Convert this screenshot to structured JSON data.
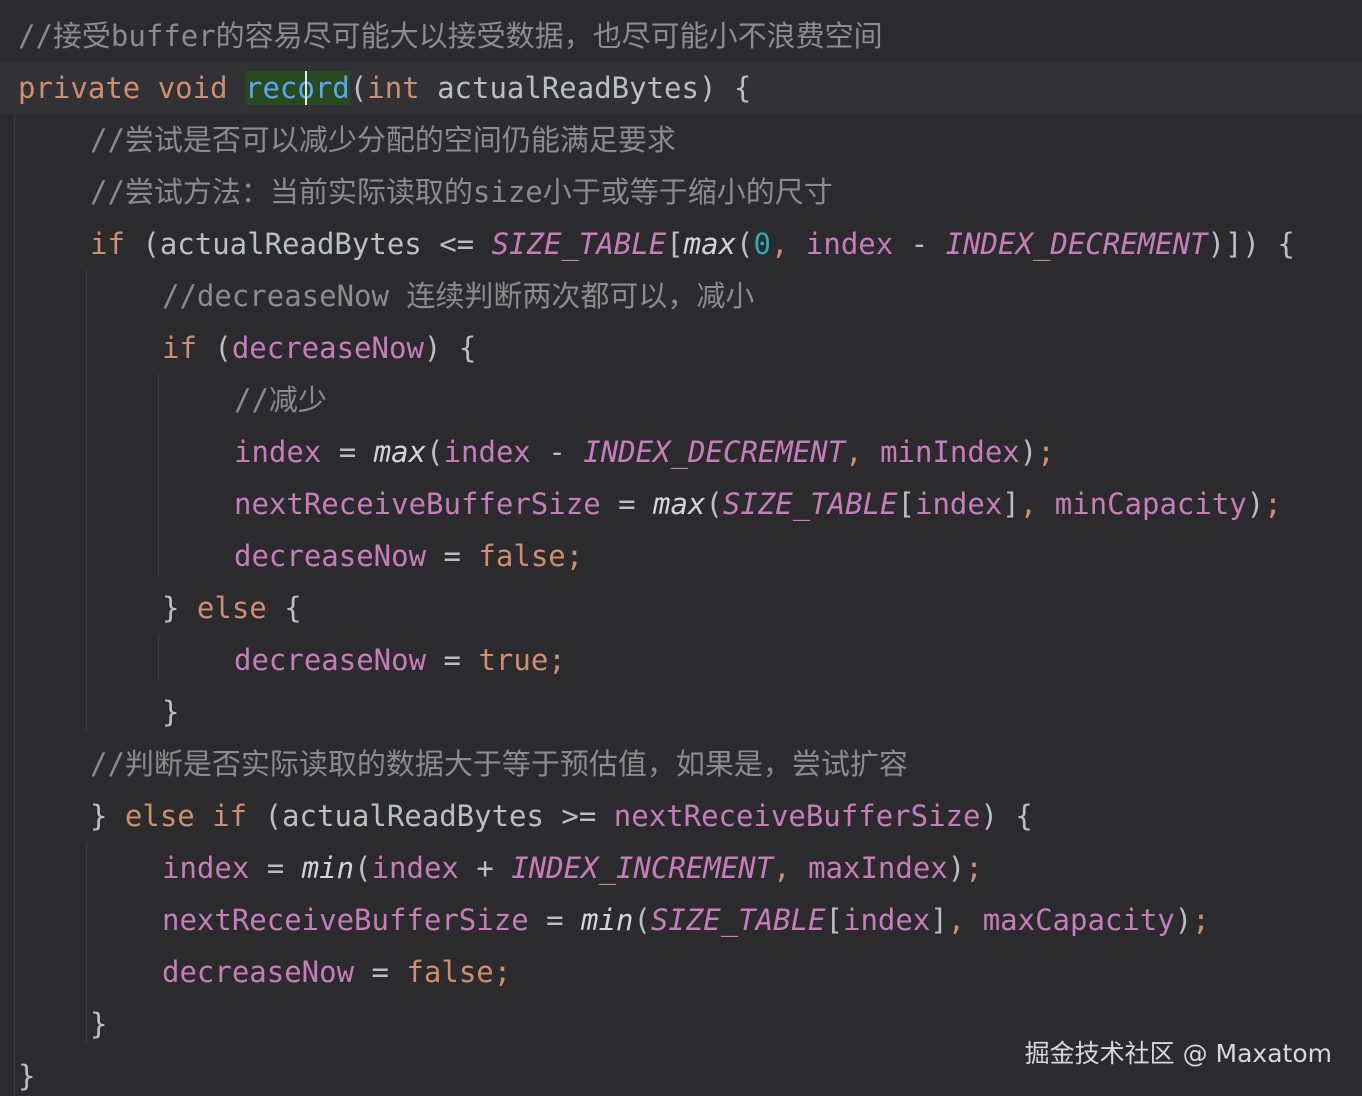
{
  "code": {
    "lines": [
      {
        "indent": 0,
        "tokens": [
          {
            "t": "//接受buffer的容易尽可能大以接受数据，也尽可能小不浪费空间",
            "c": "comment"
          }
        ]
      },
      {
        "indent": 0,
        "current": true,
        "tokens": [
          {
            "t": "private",
            "c": "keyword"
          },
          {
            "t": " ",
            "c": "plain"
          },
          {
            "t": "void",
            "c": "keyword"
          },
          {
            "t": " ",
            "c": "plain"
          },
          {
            "t": "record",
            "c": "method",
            "highlight": true
          },
          {
            "t": "(",
            "c": "plain"
          },
          {
            "t": "int",
            "c": "keyword"
          },
          {
            "t": " actualReadBytes) {",
            "c": "plain"
          }
        ]
      },
      {
        "indent": 1,
        "tokens": [
          {
            "t": "//尝试是否可以减少分配的空间仍能满足要求",
            "c": "comment"
          }
        ]
      },
      {
        "indent": 1,
        "tokens": [
          {
            "t": "//尝试方法：当前实际读取的size小于或等于缩小的尺寸",
            "c": "comment"
          }
        ]
      },
      {
        "indent": 1,
        "tokens": [
          {
            "t": "if",
            "c": "keyword"
          },
          {
            "t": " (actualReadBytes <= ",
            "c": "plain"
          },
          {
            "t": "SIZE_TABLE",
            "c": "static"
          },
          {
            "t": "[",
            "c": "plain"
          },
          {
            "t": "max",
            "c": "italic"
          },
          {
            "t": "(",
            "c": "plain"
          },
          {
            "t": "0",
            "c": "number"
          },
          {
            "t": ", ",
            "c": "keyword"
          },
          {
            "t": "index",
            "c": "field"
          },
          {
            "t": " - ",
            "c": "plain"
          },
          {
            "t": "INDEX_DECREMENT",
            "c": "static"
          },
          {
            "t": ")]) {",
            "c": "plain"
          }
        ]
      },
      {
        "indent": 2,
        "tokens": [
          {
            "t": "//decreaseNow 连续判断两次都可以，减小",
            "c": "comment"
          }
        ]
      },
      {
        "indent": 2,
        "tokens": [
          {
            "t": "if",
            "c": "keyword"
          },
          {
            "t": " (",
            "c": "plain"
          },
          {
            "t": "decreaseNow",
            "c": "field"
          },
          {
            "t": ") {",
            "c": "plain"
          }
        ]
      },
      {
        "indent": 3,
        "tokens": [
          {
            "t": "//减少",
            "c": "comment"
          }
        ]
      },
      {
        "indent": 3,
        "tokens": [
          {
            "t": "index",
            "c": "field"
          },
          {
            "t": " = ",
            "c": "plain"
          },
          {
            "t": "max",
            "c": "italic"
          },
          {
            "t": "(",
            "c": "plain"
          },
          {
            "t": "index",
            "c": "field"
          },
          {
            "t": " - ",
            "c": "plain"
          },
          {
            "t": "INDEX_DECREMENT",
            "c": "static"
          },
          {
            "t": ", ",
            "c": "keyword"
          },
          {
            "t": "minIndex",
            "c": "field"
          },
          {
            "t": ")",
            "c": "plain"
          },
          {
            "t": ";",
            "c": "keyword"
          }
        ]
      },
      {
        "indent": 3,
        "tokens": [
          {
            "t": "nextReceiveBufferSize",
            "c": "field"
          },
          {
            "t": " = ",
            "c": "plain"
          },
          {
            "t": "max",
            "c": "italic"
          },
          {
            "t": "(",
            "c": "plain"
          },
          {
            "t": "SIZE_TABLE",
            "c": "static"
          },
          {
            "t": "[",
            "c": "plain"
          },
          {
            "t": "index",
            "c": "field"
          },
          {
            "t": "]",
            "c": "plain"
          },
          {
            "t": ", ",
            "c": "keyword"
          },
          {
            "t": "minCapacity",
            "c": "field"
          },
          {
            "t": ")",
            "c": "plain"
          },
          {
            "t": ";",
            "c": "keyword"
          }
        ]
      },
      {
        "indent": 3,
        "tokens": [
          {
            "t": "decreaseNow",
            "c": "field"
          },
          {
            "t": " = ",
            "c": "plain"
          },
          {
            "t": "false",
            "c": "keyword"
          },
          {
            "t": ";",
            "c": "keyword"
          }
        ]
      },
      {
        "indent": 2,
        "tokens": [
          {
            "t": "} ",
            "c": "plain"
          },
          {
            "t": "else",
            "c": "keyword"
          },
          {
            "t": " {",
            "c": "plain"
          }
        ]
      },
      {
        "indent": 3,
        "tokens": [
          {
            "t": "decreaseNow",
            "c": "field"
          },
          {
            "t": " = ",
            "c": "plain"
          },
          {
            "t": "true",
            "c": "keyword"
          },
          {
            "t": ";",
            "c": "keyword"
          }
        ]
      },
      {
        "indent": 2,
        "tokens": [
          {
            "t": "}",
            "c": "plain"
          }
        ]
      },
      {
        "indent": 1,
        "tokens": [
          {
            "t": "//判断是否实际读取的数据大于等于预估值，如果是，尝试扩容",
            "c": "comment"
          }
        ]
      },
      {
        "indent": 1,
        "tokens": [
          {
            "t": "} ",
            "c": "plain"
          },
          {
            "t": "else if",
            "c": "keyword"
          },
          {
            "t": " (actualReadBytes >= ",
            "c": "plain"
          },
          {
            "t": "nextReceiveBufferSize",
            "c": "field"
          },
          {
            "t": ") {",
            "c": "plain"
          }
        ]
      },
      {
        "indent": 2,
        "tokens": [
          {
            "t": "index",
            "c": "field"
          },
          {
            "t": " = ",
            "c": "plain"
          },
          {
            "t": "min",
            "c": "italic"
          },
          {
            "t": "(",
            "c": "plain"
          },
          {
            "t": "index",
            "c": "field"
          },
          {
            "t": " + ",
            "c": "plain"
          },
          {
            "t": "INDEX_INCREMENT",
            "c": "static"
          },
          {
            "t": ", ",
            "c": "keyword"
          },
          {
            "t": "maxIndex",
            "c": "field"
          },
          {
            "t": ")",
            "c": "plain"
          },
          {
            "t": ";",
            "c": "keyword"
          }
        ]
      },
      {
        "indent": 2,
        "tokens": [
          {
            "t": "nextReceiveBufferSize",
            "c": "field"
          },
          {
            "t": " = ",
            "c": "plain"
          },
          {
            "t": "min",
            "c": "italic"
          },
          {
            "t": "(",
            "c": "plain"
          },
          {
            "t": "SIZE_TABLE",
            "c": "static"
          },
          {
            "t": "[",
            "c": "plain"
          },
          {
            "t": "index",
            "c": "field"
          },
          {
            "t": "]",
            "c": "plain"
          },
          {
            "t": ", ",
            "c": "keyword"
          },
          {
            "t": "maxCapacity",
            "c": "field"
          },
          {
            "t": ")",
            "c": "plain"
          },
          {
            "t": ";",
            "c": "keyword"
          }
        ]
      },
      {
        "indent": 2,
        "tokens": [
          {
            "t": "decreaseNow",
            "c": "field"
          },
          {
            "t": " = ",
            "c": "plain"
          },
          {
            "t": "false",
            "c": "keyword"
          },
          {
            "t": ";",
            "c": "keyword"
          }
        ]
      },
      {
        "indent": 1,
        "tokens": [
          {
            "t": "}",
            "c": "plain"
          }
        ]
      },
      {
        "indent": 0,
        "tokens": [
          {
            "t": "}",
            "c": "plain"
          }
        ]
      }
    ]
  },
  "colors": {
    "background": "#2b2b2d",
    "current_line": "#323236",
    "comment": "#8c8c8c",
    "keyword": "#cf8e6d",
    "plain": "#bcbec4",
    "field": "#c77dbb",
    "static": "#c77dbb",
    "italic": "#d5d5d5",
    "method": "#56a8f5",
    "number": "#2aacb8",
    "highlight_bg": "#294a1f",
    "indent_guide": "#3c3c40"
  },
  "watermark": "掘金技术社区 @ Maxatom"
}
